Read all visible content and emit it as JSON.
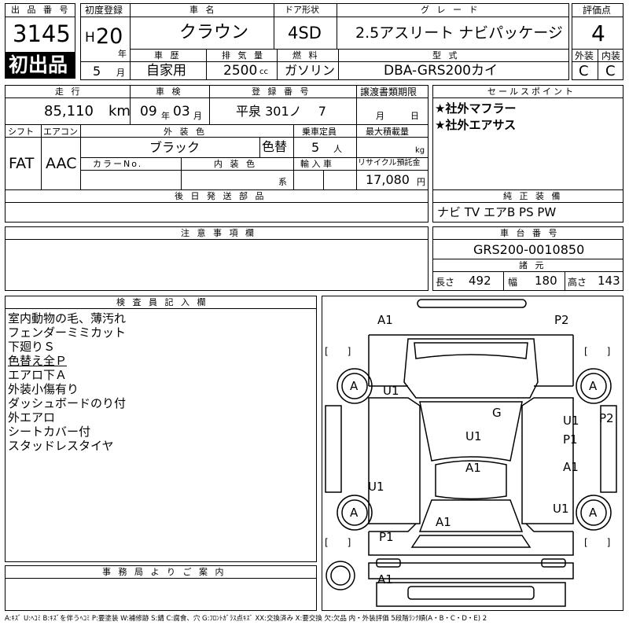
{
  "header": {
    "lot_label": "出 品 番 号",
    "lot_number": "3145",
    "first_listing": "初出品",
    "reg_label": "初度登録",
    "reg_era": "H",
    "reg_year": "20",
    "reg_year_unit": "年",
    "reg_month": "5",
    "reg_month_unit": "月",
    "car_name_label": "車 名",
    "car_name": "クラウン",
    "door_label": "ドア形状",
    "door": "4SD",
    "grade_label": "グ レ ー ド",
    "grade": "2.5アスリート ナビパッケージ",
    "history_label": "車 歴",
    "history": "自家用",
    "displacement_label": "排 気 量",
    "displacement": "2500",
    "displacement_unit": "cc",
    "fuel_label": "燃 料",
    "fuel": "ガソリン",
    "model_label": "型 式",
    "model": "DBA-GRS200カイ",
    "score_label": "評価点",
    "score": "4",
    "exterior_label": "外装",
    "exterior": "C",
    "interior_label": "内装",
    "interior": "C"
  },
  "row2": {
    "mileage_label": "走 行",
    "mileage": "85,110",
    "mileage_unit": "km",
    "inspection_label": "車 検",
    "inspection_year": "09",
    "inspection_year_unit": "年",
    "inspection_month": "03",
    "inspection_month_unit": "月",
    "plate_label": "登 録 番 号",
    "plate": "平泉 301ノ　 7",
    "transfer_label": "譲渡書類期限",
    "transfer_month_unit": "月",
    "transfer_day_unit": "日",
    "shift_label": "シフト",
    "shift": "FAT",
    "ac_label": "エアコン",
    "ac": "AAC",
    "color_label": "外 装 色",
    "color": "ブラック",
    "repaint": "色替",
    "capacity_label": "乗車定員",
    "capacity": "5",
    "capacity_unit": "人",
    "load_label": "最大積載量",
    "load_unit": "kg",
    "color_no_label": "カラーNo.",
    "interior_color_label": "内 装 色",
    "interior_color_unit": "系",
    "import_label": "輸 入 車",
    "recycle_label": "リサイクル預託金",
    "recycle": "17,080",
    "recycle_unit": "円",
    "parts_label": "後 日 発 送 部 品"
  },
  "sales": {
    "label": "セールスポイント",
    "points": [
      "★社外マフラー",
      "★社外エアサス"
    ]
  },
  "equipment": {
    "label": "純 正 装 備",
    "value": "ナビ TV エアB PS PW"
  },
  "notes_label": "注 意 事 項 欄",
  "chassis": {
    "label": "車 台 番 号",
    "value": "GRS200-0010850",
    "spec_label": "諸 元",
    "length_label": "長さ",
    "length": "492",
    "width_label": "幅",
    "width": "180",
    "height_label": "高さ",
    "height": "143"
  },
  "inspector": {
    "label": "検 査 員 記 入 欄",
    "lines": [
      "室内動物の毛、薄汚れ",
      "フェンダーミミカット",
      "下廻りＳ",
      "色替え全Ｐ",
      "エアロ下Ａ",
      "外装小傷有り",
      "ダッシュボードのり付",
      "外エアロ",
      "シートカバー付",
      "スタッドレスタイヤ"
    ]
  },
  "office_label": "事 務 局 よ り ご 案 内",
  "diagram": {
    "tire": "A",
    "bracket": "[　　]",
    "marks": [
      "A1",
      "P2",
      "U1",
      "G",
      "U1",
      "P2",
      "P1",
      "U1",
      "A1",
      "U1",
      "A1",
      "U1",
      "A1",
      "P1",
      "A1"
    ]
  },
  "legend": "A:ｷｽﾞ U:ﾍｺﾐ B:ｷｽﾞを伴うﾍｺﾐ P:要塗装 W:補修跡 S:錆 C:腐食、穴 G:ﾌﾛﾝﾄｶﾞﾗｽ点ｷｽﾞ XX:交換済み X:要交換 欠:欠品 内・外装評価 5段階ﾗﾝｸ順(A・B・C・D・E) 2"
}
